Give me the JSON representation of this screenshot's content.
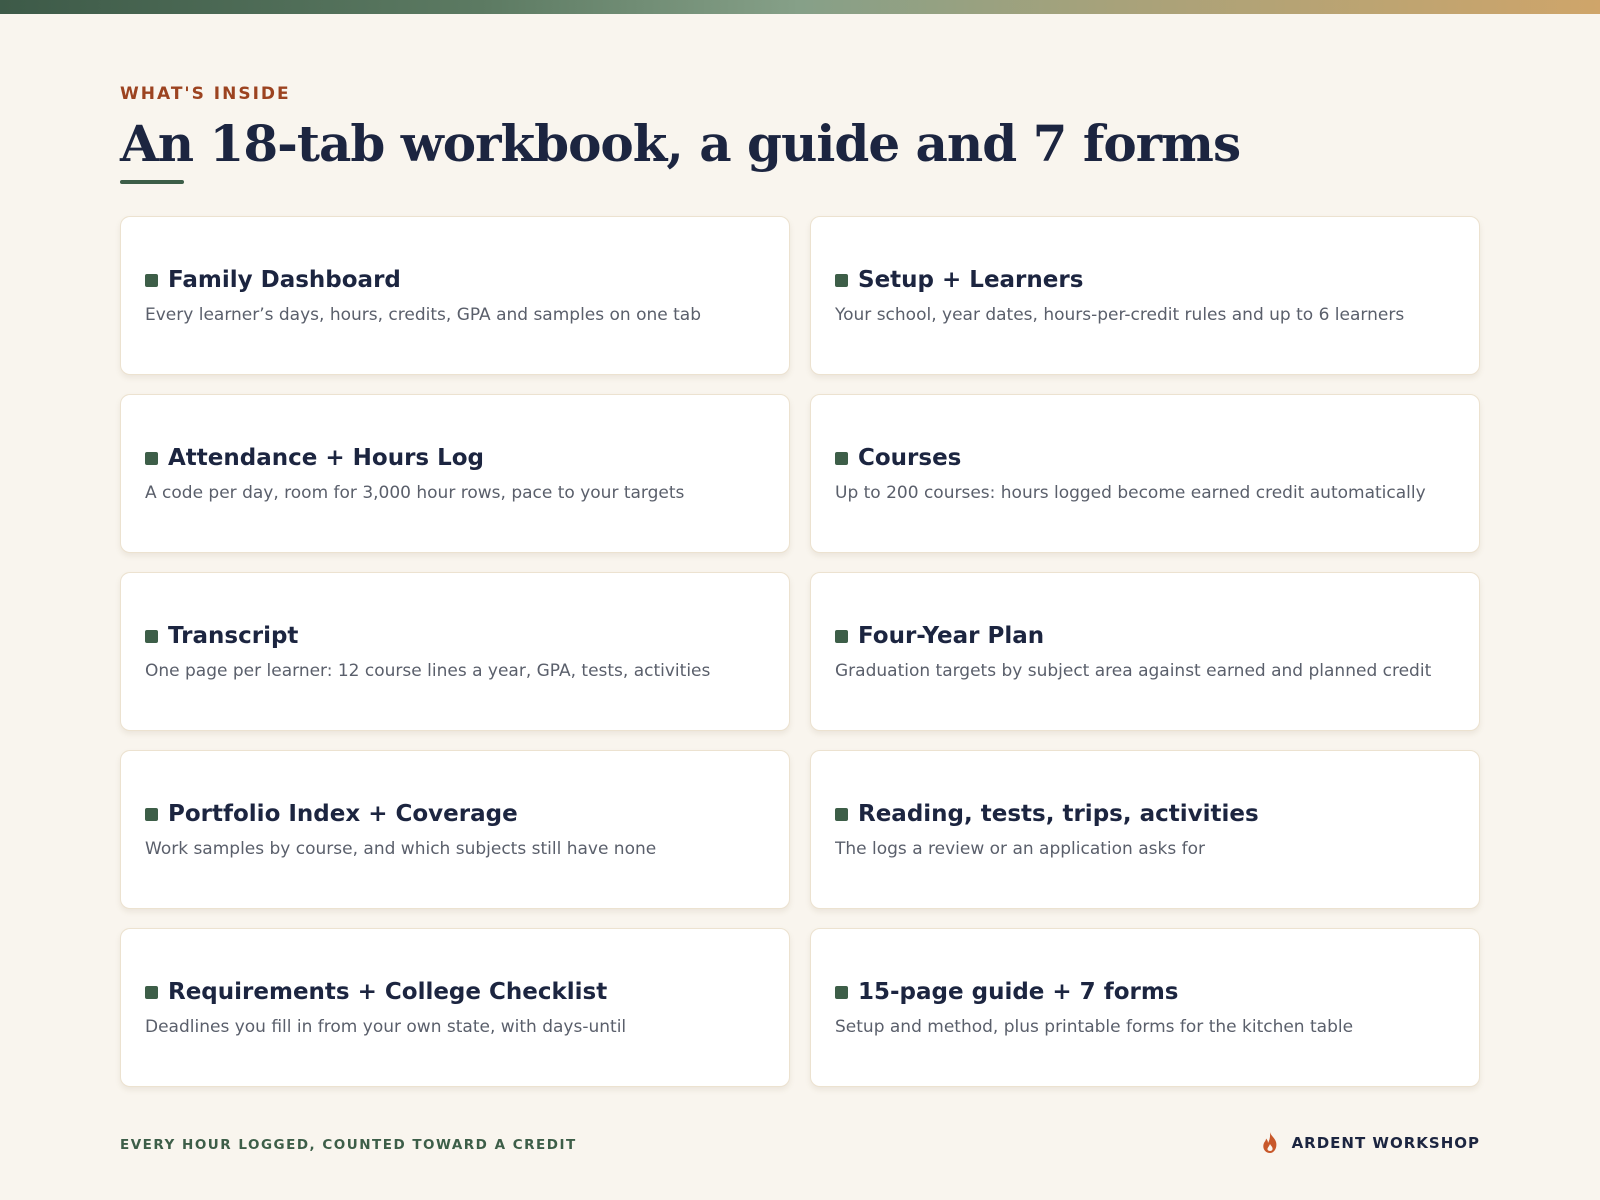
{
  "header": {
    "eyebrow": "WHAT'S INSIDE",
    "title": "An 18-tab workbook, a guide and 7 forms"
  },
  "cards": [
    {
      "title": "Family Dashboard",
      "desc": "Every learner’s days, hours, credits, GPA and samples on one tab"
    },
    {
      "title": "Setup + Learners",
      "desc": "Your school, year dates, hours-per-credit rules and up to 6 learners"
    },
    {
      "title": "Attendance + Hours Log",
      "desc": "A code per day, room for 3,000 hour rows, pace to your targets"
    },
    {
      "title": "Courses",
      "desc": "Up to 200 courses: hours logged become earned credit automatically"
    },
    {
      "title": "Transcript",
      "desc": "One page per learner: 12 course lines a year, GPA, tests, activities"
    },
    {
      "title": "Four-Year Plan",
      "desc": "Graduation targets by subject area against earned and planned credit"
    },
    {
      "title": "Portfolio Index + Coverage",
      "desc": "Work samples by course, and which subjects still have none"
    },
    {
      "title": "Reading, tests, trips, activities",
      "desc": "The logs a review or an application asks for"
    },
    {
      "title": "Requirements + College Checklist",
      "desc": "Deadlines you fill in from your own state, with days-until"
    },
    {
      "title": "15-page guide + 7 forms",
      "desc": "Setup and method, plus printable forms for the kitchen table"
    }
  ],
  "footer": {
    "tagline": "EVERY HOUR LOGGED, COUNTED TOWARD A CREDIT",
    "brand": "ARDENT WORKSHOP",
    "brand_icon": "flame-icon"
  },
  "colors": {
    "accent_green": "#3d5e48",
    "eyebrow_rust": "#9c4320",
    "navy": "#1c2540",
    "background": "#f9f5ee",
    "flame": "#c8582a"
  }
}
